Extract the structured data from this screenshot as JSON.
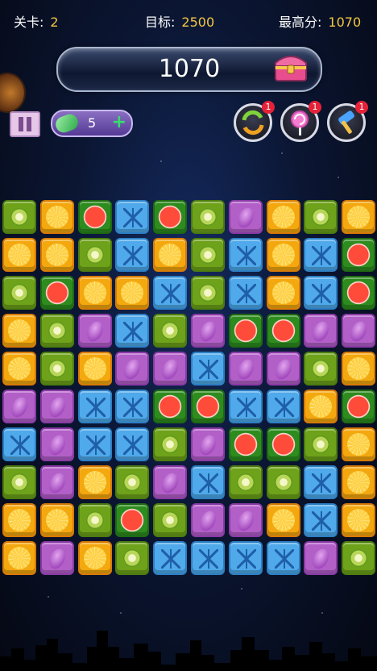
{
  "header": {
    "level_label": "关卡:",
    "level_value": "2",
    "target_label": "目标:",
    "target_value": "2500",
    "best_label": "最高分:",
    "best_value": "1070"
  },
  "score": "1070",
  "gem_count": "5",
  "tools": [
    {
      "name": "refresh-tool-icon",
      "badge": "1"
    },
    {
      "name": "lollipop-tool-icon",
      "badge": "1"
    },
    {
      "name": "hammer-tool-icon",
      "badge": "1"
    }
  ],
  "board": {
    "rows": [
      [
        "kiwi",
        "orange",
        "melon",
        "ice",
        "melon",
        "kiwi",
        "grape",
        "orange",
        "kiwi",
        "orange"
      ],
      [
        "orange",
        "orange",
        "kiwi",
        "ice",
        "orange",
        "kiwi",
        "ice",
        "orange",
        "ice",
        "melon"
      ],
      [
        "kiwi",
        "melon",
        "orange",
        "orange",
        "ice",
        "kiwi",
        "ice",
        "orange",
        "ice",
        "melon"
      ],
      [
        "orange",
        "kiwi",
        "grape",
        "ice",
        "kiwi",
        "grape",
        "melon",
        "melon",
        "grape",
        "grape"
      ],
      [
        "orange",
        "kiwi",
        "orange",
        "grape",
        "grape",
        "ice",
        "grape",
        "grape",
        "kiwi",
        "orange"
      ],
      [
        "grape",
        "grape",
        "ice",
        "ice",
        "melon",
        "melon",
        "ice",
        "ice",
        "orange",
        "melon"
      ],
      [
        "ice",
        "grape",
        "ice",
        "ice",
        "kiwi",
        "grape",
        "melon",
        "melon",
        "kiwi",
        "orange"
      ],
      [
        "kiwi",
        "grape",
        "orange",
        "kiwi",
        "grape",
        "ice",
        "kiwi",
        "kiwi",
        "ice",
        "orange"
      ],
      [
        "orange",
        "orange",
        "kiwi",
        "melon",
        "kiwi",
        "grape",
        "grape",
        "orange",
        "ice",
        "orange"
      ],
      [
        "orange",
        "grape",
        "orange",
        "kiwi",
        "ice",
        "ice",
        "ice",
        "ice",
        "grape",
        "kiwi"
      ]
    ]
  }
}
